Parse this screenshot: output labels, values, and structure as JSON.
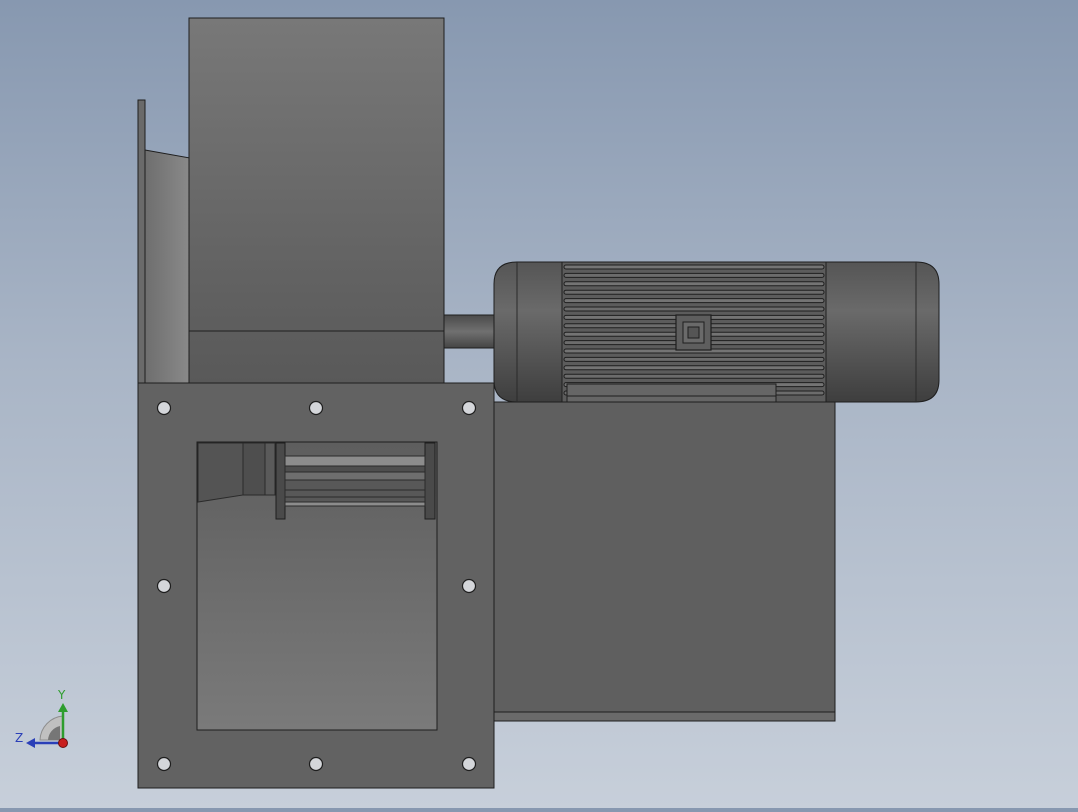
{
  "scene": {
    "view": "front",
    "colors": {
      "background_top": "#8798b0",
      "background_bottom": "#c7cfda",
      "body": "#5f5f5f",
      "edge": "#1e1e1e",
      "bolt_hole": "#d4d6da"
    }
  },
  "triad": {
    "y_label": "Y",
    "z_label": "Z",
    "colors": {
      "y": "#2e9d2e",
      "z": "#2a3fb8",
      "x": "#c81e1e"
    }
  }
}
